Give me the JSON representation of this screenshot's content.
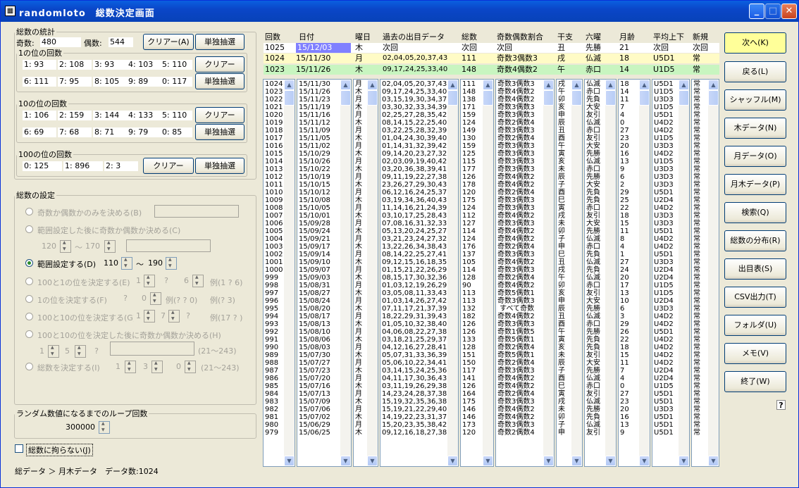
{
  "window": {
    "title": "randomloto　総数決定画面",
    "icon": "app-icon"
  },
  "stats": {
    "legend": "総数の統計",
    "odd_label": "奇数:",
    "odd_value": "480",
    "even_label": "偶数:",
    "even_value": "544",
    "clear": "クリアー(A)",
    "draw": "単独抽選",
    "ones_legend": "1の位の回数",
    "ones": [
      "1: 93",
      "2: 108",
      "3: 93",
      "4: 103",
      "5: 110",
      "6: 111",
      "7: 95",
      "8: 105",
      "9: 89",
      "0: 117"
    ],
    "tens_legend": "10の位の回数",
    "tens": [
      "1: 106",
      "2: 159",
      "3: 144",
      "4: 133",
      "5: 110",
      "6: 69",
      "7: 68",
      "8: 71",
      "9: 79",
      "0: 85"
    ],
    "hund_legend": "100の位の回数",
    "hund": [
      "0: 125",
      "1: 896",
      "2: 3"
    ],
    "clear2": "クリアー"
  },
  "settings": {
    "legend": "総数の設定",
    "opt1": "奇数か偶数かのみを決める(B)",
    "opt2": "範囲設定した後に奇数か偶数か決める(C)",
    "opt2_from": "120",
    "opt2_to": "170",
    "tilde": "〜",
    "opt3": "範囲設定する(D)",
    "opt3_from": "110",
    "opt3_to": "190",
    "opt4": "100と1の位を決定する(E)",
    "opt4_a": "1",
    "opt4_b": "?",
    "opt4_c": "6",
    "opt4_ex": "例(1 ? 6)",
    "opt5": "1の位を決定する(F)",
    "opt5_a": "?",
    "opt5_b": "0",
    "opt5_ex1": "例(? ? 0)",
    "opt5_ex2": "例(? 3)",
    "opt6": "100と10の位を決定する(G)",
    "opt6_a": "1",
    "opt6_b": "7",
    "opt6_c": "?",
    "opt6_ex": "例(17 ? )",
    "opt7": "100と10の位を決定した後に奇数か偶数か決める(H)",
    "opt7_a": "1",
    "opt7_b": "5",
    "opt7_c": "?",
    "opt7_range": "(21〜243)",
    "opt8": "総数を決定する(I)",
    "opt8_a": "1",
    "opt8_b": "3",
    "opt8_c": "0",
    "opt8_range": "(21〜243)"
  },
  "loop": {
    "legend": "ランダム数値になるまでのループ回数",
    "value": "300000"
  },
  "nolimit": "総数に拘らない(J)",
  "status": "総データ ＞ 月木データ　データ数:1024",
  "headers": [
    "回数",
    "日付",
    "曜日",
    "過去の出目データ",
    "総数",
    "奇数偶数割合",
    "干支",
    "六曜",
    "月齢",
    "平均上下",
    "新規"
  ],
  "next_row": [
    "1025",
    "15/12/03",
    "木",
    "次回",
    "次回",
    "次回",
    "丑",
    "先勝",
    "21",
    "次回",
    "次回"
  ],
  "hl_rows": [
    [
      "1024",
      "15/11/30",
      "月",
      "02,04,05,20,37,43",
      "111",
      "奇数3偶数3",
      "戌",
      "仏滅",
      "18",
      "U5D1",
      "常"
    ],
    [
      "1023",
      "15/11/26",
      "木",
      "09,17,24,25,33,40",
      "148",
      "奇数4偶数2",
      "午",
      "赤口",
      "14",
      "U1D5",
      "常"
    ]
  ],
  "list": {
    "kaisu": "1024\n1023\n1022\n1021\n1020\n1019\n1018\n1017\n1016\n1015\n1014\n1013\n1012\n1011\n1010\n1009\n1008\n1007\n1006\n1005\n1004\n1003\n1002\n1001\n1000\n999\n998\n997\n996\n995\n994\n993\n992\n991\n990\n989\n988\n987\n986\n985\n984\n983\n982\n981\n980\n979",
    "date": "15/11/30\n15/11/26\n15/11/23\n15/11/19\n15/11/16\n15/11/12\n15/11/09\n15/11/05\n15/11/02\n15/10/29\n15/10/26\n15/10/22\n15/10/19\n15/10/15\n15/10/12\n15/10/08\n15/10/05\n15/10/01\n15/09/28\n15/09/24\n15/09/21\n15/09/17\n15/09/14\n15/09/10\n15/09/07\n15/09/03\n15/08/31\n15/08/27\n15/08/24\n15/08/20\n15/08/17\n15/08/13\n15/08/10\n15/08/06\n15/08/03\n15/07/30\n15/07/27\n15/07/23\n15/07/20\n15/07/16\n15/07/13\n15/07/09\n15/07/06\n15/07/02\n15/06/29\n15/06/25",
    "dow": "月\n木\n月\n木\n月\n木\n月\n木\n月\n木\n月\n木\n月\n木\n月\n木\n月\n木\n月\n木\n月\n木\n月\n木\n月\n木\n月\n木\n月\n木\n月\n木\n月\n木\n月\n木\n月\n木\n月\n木\n月\n木\n月\n木\n月\n木",
    "nums": "02,04,05,20,37,43\n09,17,24,25,33,40\n03,15,19,30,34,37\n03,30,32,33,34,39\n02,25,27,28,35,42\n08,14,15,22,25,40\n03,22,25,28,32,39\n01,04,24,30,39,40\n01,14,31,32,39,42\n09,14,20,23,27,32\n02,03,09,19,40,42\n03,20,36,38,39,41\n09,11,19,22,27,38\n23,26,27,29,30,43\n06,12,16,24,25,37\n03,19,34,36,40,43\n11,14,16,21,24,39\n03,10,17,25,28,43\n07,08,16,31,32,33\n05,13,20,24,25,27\n03,21,23,24,27,32\n13,22,26,34,38,43\n08,14,22,25,27,41\n09,12,15,16,18,35\n01,15,21,22,26,29\n08,15,17,30,32,36\n01,03,12,19,26,29\n03,05,08,11,33,43\n01,03,14,26,27,42\n07,11,17,21,37,39\n18,22,29,31,39,43\n01,05,10,32,38,40\n04,06,08,22,27,38\n03,18,21,25,29,37\n04,12,16,27,28,41\n05,07,31,33,36,39\n05,06,10,22,34,41\n03,14,15,24,25,36\n04,11,17,30,36,43\n03,11,19,26,29,38\n14,23,24,28,37,38\n15,19,32,35,36,38\n15,19,21,22,29,40\n14,19,22,23,31,37\n15,20,23,35,38,42\n09,12,16,18,27,38",
    "total": "111\n148\n138\n171\n159\n124\n149\n130\n159\n125\n115\n177\n126\n178\n120\n175\n124\n112\n127\n114\n124\n176\n137\n105\n114\n128\n90\n113\n113\n132\n182\n126\n126\n133\n128\n151\n150\n117\n141\n126\n164\n175\n146\n146\n173\n120",
    "ratio": "奇数3偶数3\n奇数4偶数2\n奇数4偶数2\n奇数3偶数3\n奇数3偶数3\n奇数2偶数4\n奇数3偶数3\n奇数2偶数4\n奇数3偶数3\n奇数3偶数3\n奇数3偶数3\n奇数3偶数3\n奇数4偶数2\n奇数4偶数2\n奇数2偶数4\n奇数3偶数3\n奇数3偶数3\n奇数4偶数2\n奇数3偶数3\n奇数4偶数2\n奇数4偶数2\n奇数2偶数4\n奇数3偶数3\n奇数4偶数2\n奇数3偶数3\n奇数2偶数4\n奇数4偶数2\n奇数5偶数1\n奇数3偶数3\n すべて奇数\n奇数4偶数2\n奇数3偶数3\n奇数1偶数5\n奇数5偶数1\n奇数2偶数4\n奇数5偶数1\n奇数2偶数4\n奇数3偶数3\n奇数4偶数2\n奇数4偶数2\n奇数2偶数4\n奇数3偶数3\n奇数4偶数2\n奇数4偶数2\n奇数3偶数3\n奇数2偶数4",
    "eto": "戌\n午\n卯\n亥\n申\n辰\n丑\n酉\n午\n寅\n亥\n未\n辰\n子\n酉\n巳\n寅\n戌\n未\n卯\n子\n申\n巳\n丑\n戌\n午\n卯\n亥\n申\n辰\n丑\n酉\n午\n寅\n亥\n未\n辰\n子\n酉\n巳\n寅\n戌\n未\n卯\n子\n申",
    "rokuyo": "仏滅\n赤口\n先負\n大安\n友引\n仏滅\n赤口\n友引\n大安\n先勝\n仏滅\n赤口\n先勝\n大安\n先負\n先負\n赤口\n友引\n大安\n先勝\n仏滅\n赤口\n先負\n仏滅\n先負\n仏滅\n赤口\n友引\n大安\n先勝\n仏滅\n赤口\n先勝\n先負\n先負\n友引\n大安\n先勝\n仏滅\n赤口\n友引\n仏滅\n先勝\n先負\n仏滅\n友引",
    "moon": "18\n14\n11\n7\n4\n0\n27\n23\n20\n16\n13\n9\n6\n2\n29\n25\n22\n18\n15\n11\n8\n4\n1\n27\n24\n20\n17\n13\n10\n6\n3\n29\n26\n22\n18\n15\n11\n7\n4\n0\n27\n23\n20\n16\n13\n9",
    "avg": "U5D1\nU1D5\nU3D3\nU1D5\nU5D1\nU4D2\nU4D2\nU1D5\nU3D3\nU4D2\nU1D5\nU3D3\nU3D3\nU3D3\nU5D1\nU2D4\nU4D2\nU3D3\nU3D3\nU5D1\nU4D2\nU4D2\nU5D1\nU3D3\nU2D4\nU2D4\nU1D5\nU1D5\nU2D4\nU3D3\nU4D2\nU4D2\nU5D1\nU4D2\nU4D2\nU4D2\nU4D2\nU2D4\nU2D4\nU1D5\nU5D1\nU5D1\nU3D3\nU5D1\nU5D1\nU5D1",
    "new": "常\n常\n常\n常\n常\n常\n常\n常\n常\n常\n常\n常\n常\n常\n常\n常\n常\n常\n常\n常\n常\n常\n常\n常\n常\n常\n常\n常\n常\n常\n常\n常\n常\n常\n常\n常\n常\n常\n常\n常\n常\n常\n常\n常\n常\n常"
  },
  "right_buttons": [
    "次へ(K)",
    "戻る(L)",
    "シャッフル(M)",
    "木データ(N)",
    "月データ(O)",
    "月木データ(P)",
    "検索(Q)",
    "総数の分布(R)",
    "出目表(S)",
    "CSV出力(T)",
    "フォルダ(U)",
    "メモ(V)",
    "終了(W)"
  ],
  "help": "?",
  "colors": {
    "highlight1": "#fffbc6",
    "highlight2": "#c8f5c0",
    "next_date_bg": "#8080ff",
    "active_btn": "#ffff99"
  }
}
